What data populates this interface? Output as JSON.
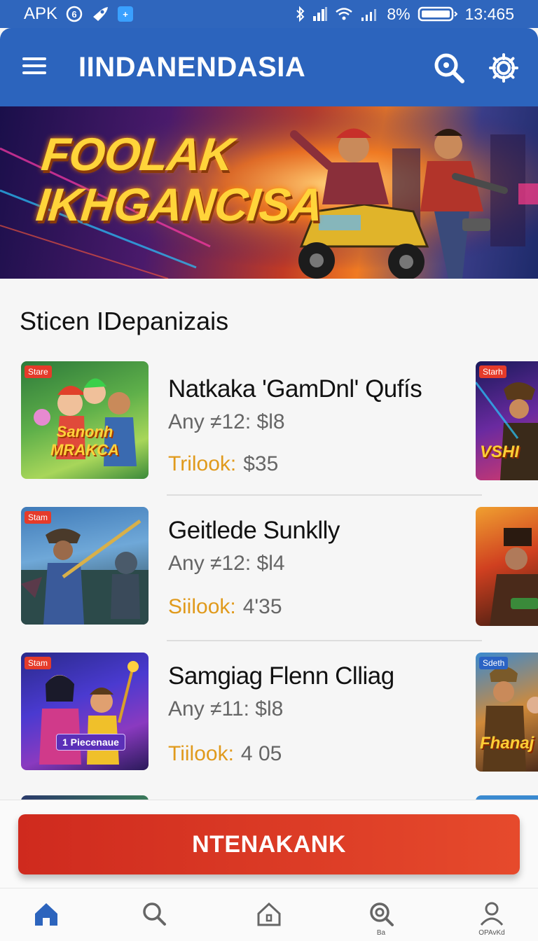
{
  "status_bar": {
    "carrier": "APK",
    "battery": "8%",
    "time": "13:465"
  },
  "app_bar": {
    "title": "IINDANENDASIA"
  },
  "banner": {
    "headline_line1": "FOOLAK",
    "headline_line2": "IKHGANCISA"
  },
  "section": {
    "title": "Sticen IDepanizais"
  },
  "items": [
    {
      "tag": "Stare",
      "thumb_caption": "Sanonh MRAKCA",
      "title": "Natkaka 'GamDnl' Qufís",
      "sub": "Any ≠12: $l8",
      "price_label": "Trilook:",
      "price_value": "$35",
      "side_tag": "Starh",
      "side_caption": "VSHI"
    },
    {
      "tag": "Stam",
      "thumb_caption": "",
      "title": "Geitlede Sunklly",
      "sub": "Any ≠12: $l4",
      "price_label": "Siilook:",
      "price_value": "4'35",
      "side_tag": "",
      "side_caption": ""
    },
    {
      "tag": "Stam",
      "thumb_caption": "1 Piecenaue",
      "title": "Samgiag Flenn Clliag",
      "sub": "Any ≠11: $l8",
      "price_label": "Tiilook:",
      "price_value": "4 05",
      "side_tag": "Sdeth",
      "side_caption": "Fhanaj"
    }
  ],
  "cta": {
    "label": "NTENAKANK"
  },
  "bottom_nav": {
    "items": [
      {
        "icon": "home-icon",
        "label": ""
      },
      {
        "icon": "search-icon",
        "label": ""
      },
      {
        "icon": "house-outline-icon",
        "label": ""
      },
      {
        "icon": "zoom-icon",
        "label": "Ba"
      },
      {
        "icon": "profile-icon",
        "label": "OPAvKd"
      }
    ]
  },
  "colors": {
    "primary": "#2c64bd",
    "cta": "#d8321f",
    "accent": "#e09a1c"
  }
}
